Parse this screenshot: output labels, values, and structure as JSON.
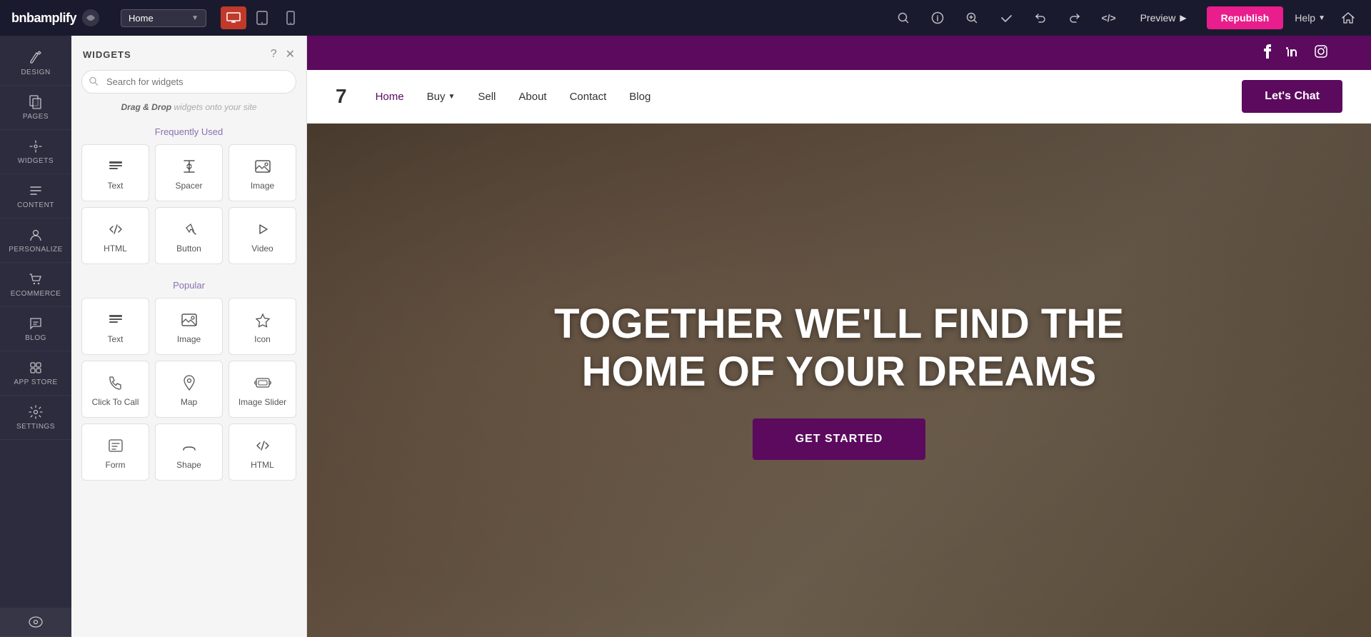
{
  "topBar": {
    "logoText": "bnbamplify",
    "pageSelector": "Home",
    "devices": [
      {
        "name": "desktop",
        "icon": "🖥",
        "active": true
      },
      {
        "name": "tablet",
        "icon": "⬜",
        "active": false
      },
      {
        "name": "mobile",
        "icon": "📱",
        "active": false
      }
    ],
    "icons": {
      "search": "🔍",
      "info": "ℹ",
      "zoom": "🔍",
      "check": "✓",
      "undo": "↩",
      "redo": "↪",
      "code": "</>",
      "preview": "Preview",
      "previewArrow": "▶",
      "help": "Help",
      "home": "⌂"
    },
    "republishLabel": "Republish"
  },
  "sidebar": {
    "items": [
      {
        "name": "design",
        "label": "DESIGN",
        "icon": "✏"
      },
      {
        "name": "pages",
        "label": "PAGES",
        "icon": "📄"
      },
      {
        "name": "widgets",
        "label": "WIDGETS",
        "icon": "+"
      },
      {
        "name": "content",
        "label": "CONTENT",
        "icon": "📁"
      },
      {
        "name": "personalize",
        "label": "PERSONALIZE",
        "icon": "👤"
      },
      {
        "name": "ecommerce",
        "label": "ECOMMERCE",
        "icon": "🛒"
      },
      {
        "name": "blog",
        "label": "BLOG",
        "icon": "💬"
      },
      {
        "name": "app-store",
        "label": "APP STORE",
        "icon": "🔧"
      },
      {
        "name": "settings",
        "label": "SETTINGS",
        "icon": "⚙"
      }
    ],
    "eyeIcon": "👁"
  },
  "widgetsPanel": {
    "title": "WIDGETS",
    "searchPlaceholder": "Search for widgets",
    "dragDropText": "Drag & Drop",
    "dragDropSuffix": " widgets onto your site",
    "sections": [
      {
        "name": "Frequently Used",
        "widgets": [
          {
            "name": "Text",
            "icon": "T"
          },
          {
            "name": "Spacer",
            "icon": "↕"
          },
          {
            "name": "Image",
            "icon": "🖼"
          },
          {
            "name": "HTML",
            "icon": "</>"
          },
          {
            "name": "Button",
            "icon": "☝"
          },
          {
            "name": "Video",
            "icon": "▶"
          }
        ]
      },
      {
        "name": "Popular",
        "widgets": [
          {
            "name": "Text",
            "icon": "T"
          },
          {
            "name": "Image",
            "icon": "🖼"
          },
          {
            "name": "Icon",
            "icon": "♥"
          },
          {
            "name": "Click To Call",
            "icon": "📞"
          },
          {
            "name": "Map",
            "icon": "📍"
          },
          {
            "name": "Image Slider",
            "icon": "🖼"
          },
          {
            "name": "Form",
            "icon": "📋"
          },
          {
            "name": "Shape",
            "icon": "〰"
          },
          {
            "name": "HTML",
            "icon": "</>"
          }
        ]
      }
    ],
    "helpIcon": "?",
    "closeIcon": "✕"
  },
  "sitePreview": {
    "socialBar": {
      "icons": [
        "f",
        "in",
        "📷"
      ]
    },
    "nav": {
      "number": "7",
      "links": [
        {
          "label": "Home",
          "active": true
        },
        {
          "label": "Buy",
          "hasDropdown": true
        },
        {
          "label": "Sell"
        },
        {
          "label": "About"
        },
        {
          "label": "Contact"
        },
        {
          "label": "Blog"
        }
      ],
      "ctaLabel": "Let's Chat"
    },
    "hero": {
      "title": "TOGETHER WE'LL FIND THE HOME OF YOUR DREAMS",
      "ctaLabel": "GET STARTED"
    }
  }
}
